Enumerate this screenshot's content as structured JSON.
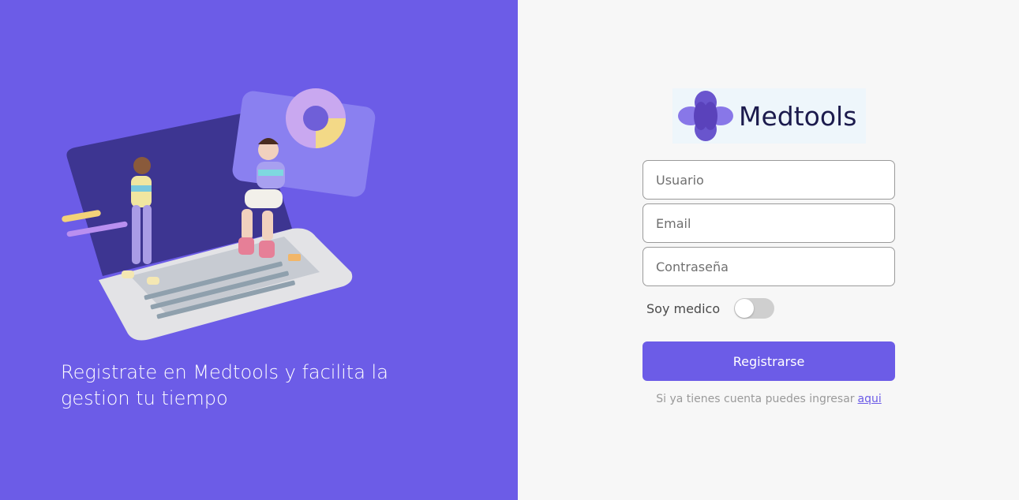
{
  "colors": {
    "accent": "#6c5ce7",
    "right_background": "#f7f7f7",
    "logo_background": "#eef6fb",
    "logo_text": "#1c1b4d"
  },
  "hero": {
    "illustration_icon": "laptop-people-illustration",
    "tagline": "Registrate en Medtools y facilita la gestion tu tiempo"
  },
  "logo": {
    "icon": "heart-flower-logo-icon",
    "text": "Medtools"
  },
  "form": {
    "username_placeholder": "Usuario",
    "email_placeholder": "Email",
    "password_placeholder": "Contraseña",
    "doctor_toggle_label": "Soy medico",
    "doctor_toggle_on": false,
    "submit_label": "Registrarse",
    "login_prompt": "Si ya tienes cuenta puedes ingresar",
    "login_link": "aqui"
  }
}
